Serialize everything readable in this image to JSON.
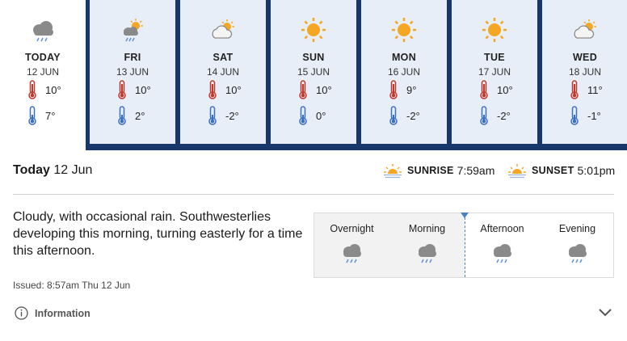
{
  "days": [
    {
      "name": "TODAY",
      "date": "12 JUN",
      "max": "10°",
      "min": "7°",
      "icon": "cloud-rain-icon"
    },
    {
      "name": "FRI",
      "date": "13 JUN",
      "max": "10°",
      "min": "2°",
      "icon": "sun-cloud-rain-icon"
    },
    {
      "name": "SAT",
      "date": "14 JUN",
      "max": "10°",
      "min": "-2°",
      "icon": "partly-cloudy-icon"
    },
    {
      "name": "SUN",
      "date": "15 JUN",
      "max": "10°",
      "min": "0°",
      "icon": "sunny-icon"
    },
    {
      "name": "MON",
      "date": "16 JUN",
      "max": "9°",
      "min": "-2°",
      "icon": "sunny-icon"
    },
    {
      "name": "TUE",
      "date": "17 JUN",
      "max": "10°",
      "min": "-2°",
      "icon": "sunny-icon"
    },
    {
      "name": "WED",
      "date": "18 JUN",
      "max": "11°",
      "min": "-1°",
      "icon": "partly-cloudy-icon"
    }
  ],
  "today": {
    "label": "Today",
    "date": "12 Jun",
    "sunrise_label": "SUNRISE",
    "sunrise_time": "7:59am",
    "sunset_label": "SUNSET",
    "sunset_time": "5:01pm",
    "description": "Cloudy, with occasional rain. Southwesterlies developing this morning, turning easterly for a time this afternoon.",
    "issued": "Issued: 8:57am Thu 12 Jun"
  },
  "periods": [
    {
      "label": "Overnight",
      "icon": "cloud-rain-icon"
    },
    {
      "label": "Morning",
      "icon": "cloud-rain-icon"
    },
    {
      "label": "Afternoon",
      "icon": "cloud-rain-icon"
    },
    {
      "label": "Evening",
      "icon": "cloud-rain-icon"
    }
  ],
  "info_label": "Information",
  "colors": {
    "strip_bg": "#18376b",
    "tile_bg": "#e8eef7",
    "sun": "#f5a623",
    "cloud": "#8a8a8a",
    "rain": "#5b8fd6",
    "thermo_hot": "#c0392b",
    "thermo_cold": "#3a6fc4"
  }
}
